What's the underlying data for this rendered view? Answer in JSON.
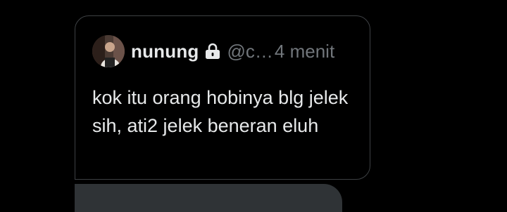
{
  "quoted_tweet": {
    "display_name": "nunung",
    "handle": "@c…",
    "time": "4 menit",
    "text": "kok itu orang hobinya blg jelek sih, ati2 jelek beneran eluh",
    "avatar_icon": "user-avatar",
    "lock_icon": "lock-icon"
  },
  "colors": {
    "background": "#000000",
    "primary_text": "#e7e9ea",
    "secondary_text": "#71767b",
    "border": "#3e4144",
    "bubble": "#2f3336"
  }
}
